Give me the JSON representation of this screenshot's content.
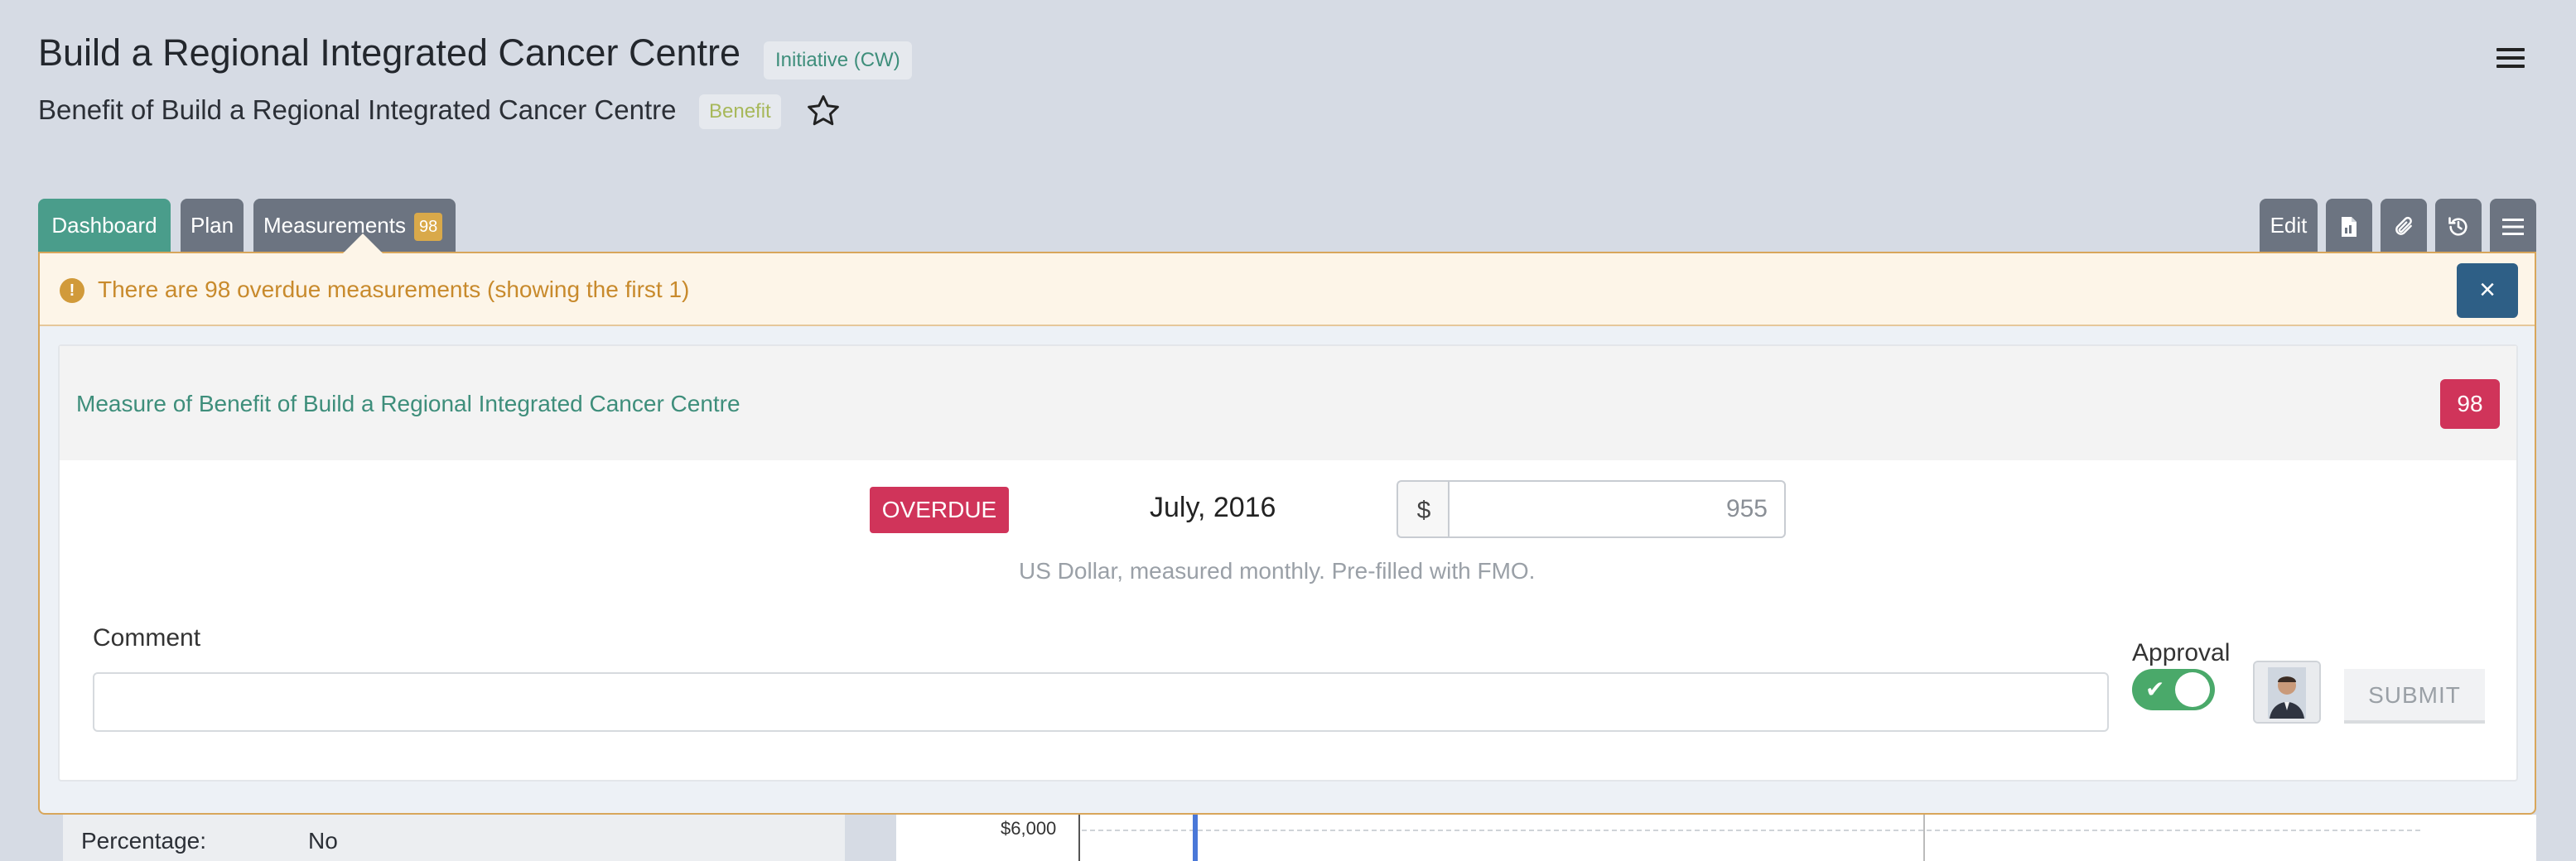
{
  "header": {
    "title": "Build a Regional Integrated Cancer Centre",
    "type_badge": "Initiative (CW)",
    "subtitle": "Benefit of Build a Regional Integrated Cancer Centre",
    "subtitle_badge": "Benefit"
  },
  "tabs": [
    {
      "label": "Dashboard"
    },
    {
      "label": "Plan"
    },
    {
      "label": "Measurements",
      "count": "98"
    }
  ],
  "toolbar": {
    "edit_label": "Edit",
    "icons": [
      "document-icon",
      "paperclip-icon",
      "history-icon",
      "menu-icon"
    ]
  },
  "alert": {
    "text": "There are 98 overdue measurements (showing the first 1)",
    "close_label": "×"
  },
  "measure": {
    "title": "Measure of Benefit of Build a Regional Integrated Cancer Centre",
    "count": "98",
    "status": "OVERDUE",
    "period": "July, 2016",
    "currency_symbol": "$",
    "value_placeholder": "955",
    "helper": "US Dollar, measured monthly. Pre-filled with FMO.",
    "comment_label": "Comment",
    "comment_value": "",
    "approval_label": "Approval",
    "approval_on": true,
    "submit_label": "SUBMIT"
  },
  "background": {
    "percentage_label": "Percentage:",
    "percentage_value": "No",
    "chart_tick": "$6,000"
  },
  "colors": {
    "accent_teal": "#4a9d8b",
    "tab_gray": "#6c7481",
    "danger": "#d0345a",
    "warning_text": "#c88a2c",
    "toggle_green": "#4aa96a",
    "close_blue": "#2e5f86"
  }
}
